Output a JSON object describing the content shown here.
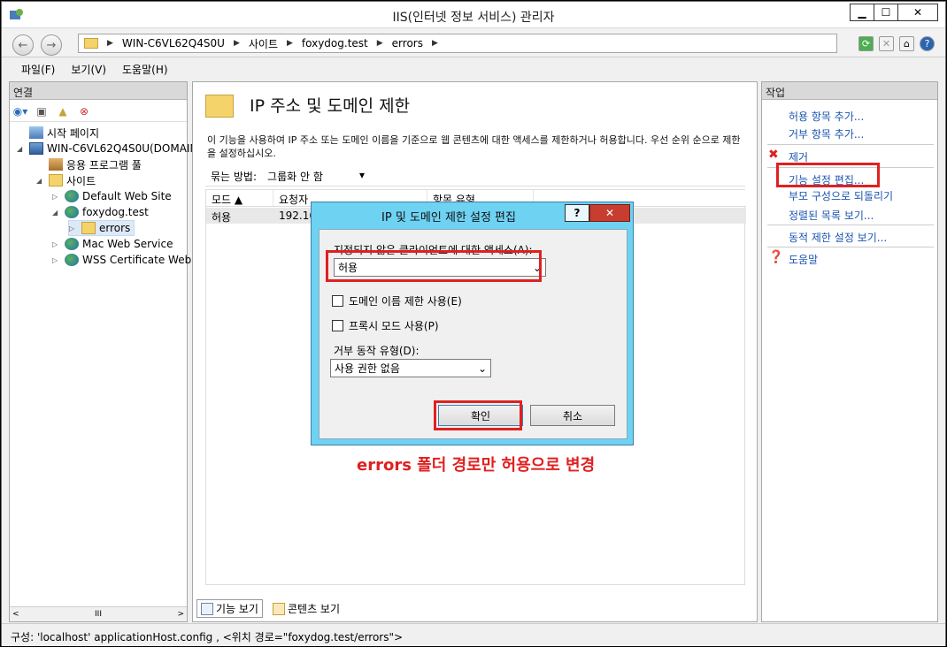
{
  "window": {
    "title": "IIS(인터넷 정보 서비스) 관리자",
    "min": "▁",
    "max": "☐",
    "close": "✕"
  },
  "address": {
    "segments": [
      "WIN-C6VL62Q4S0U",
      "사이트",
      "foxydog.test",
      "errors"
    ]
  },
  "menu": [
    "파일(F)",
    "보기(V)",
    "도움말(H)"
  ],
  "left": {
    "header": "연결",
    "tree": [
      {
        "label": "시작 페이지",
        "icon": "home-icon",
        "level": 1,
        "expander": ""
      },
      {
        "label": "WIN-C6VL62Q4S0U(DOMAIN",
        "icon": "server-icon",
        "level": 1,
        "expander": "◢"
      },
      {
        "label": "응용 프로그램 풀",
        "icon": "app-pool-icon",
        "level": 2,
        "expander": ""
      },
      {
        "label": "사이트",
        "icon": "sites-folder-icon",
        "level": 2,
        "expander": "◢"
      },
      {
        "label": "Default Web Site",
        "icon": "globe-icon",
        "level": 3,
        "expander": "▷"
      },
      {
        "label": "foxydog.test",
        "icon": "globe-icon",
        "level": 3,
        "expander": "◢"
      },
      {
        "label": "errors",
        "icon": "folder-icon",
        "level": 4,
        "expander": "▷"
      },
      {
        "label": "Mac Web Service",
        "icon": "globe-icon",
        "level": 3,
        "expander": "▷"
      },
      {
        "label": "WSS Certificate Web S",
        "icon": "globe-icon",
        "level": 3,
        "expander": "▷"
      }
    ],
    "scroll_mid": "III"
  },
  "center": {
    "title": "IP 주소 및 도메인 제한",
    "description": "이 기능을 사용하여 IP 주소 또는 도메인 이름을 기준으로 웹 콘텐츠에 대한 액세스를 제한하거나 허용합니다. 우선 순위 순으로 제한을 설정하십시오.",
    "group_label": "묶는 방법:",
    "group_value": "그룹화 안 함",
    "columns": [
      "모드 ▲",
      "요청자",
      "항목 유형"
    ],
    "rows": [
      {
        "mode": "허용",
        "requester": "192.16"
      }
    ],
    "tabs": [
      "기능 보기",
      "콘텐츠 보기"
    ]
  },
  "right": {
    "header": "작업",
    "actions": [
      "허용 항목 추가...",
      "거부 항목 추가...",
      "제거",
      "기능 설정 편집...",
      "부모 구성으로 되돌리기",
      "정렬된 목록 보기...",
      "동적 제한 설정 보기...",
      "도움말"
    ]
  },
  "dialog": {
    "title": "IP 및 도메인 제한 설정 편집",
    "help": "?",
    "close": "✕",
    "access_label": "지정되지 않은 클라이언트에 대한 액세스(A):",
    "access_value": "허용",
    "cb_domain": "도메인 이름 제한 사용(E)",
    "cb_proxy": "프록시 모드 사용(P)",
    "deny_label": "거부 동작 유형(D):",
    "deny_value": "사용 권한 없음",
    "ok": "확인",
    "cancel": "취소"
  },
  "caption": "errors 폴더 경로만 허용으로 변경",
  "status": "구성: 'localhost' applicationHost.config , <위치 경로=\"foxydog.test/errors\">",
  "colors": {
    "highlight": "#e02020",
    "dialog_frame": "#6ed2f2",
    "link": "#1a55b0"
  }
}
